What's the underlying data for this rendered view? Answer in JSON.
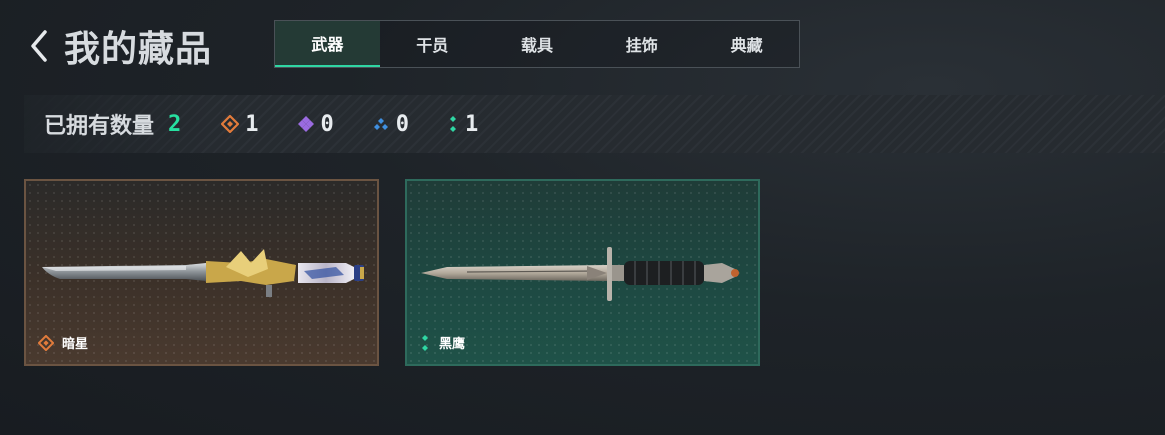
{
  "header": {
    "title": "我的藏品"
  },
  "tabs": [
    {
      "label": "武器",
      "active": true
    },
    {
      "label": "干员",
      "active": false
    },
    {
      "label": "载具",
      "active": false
    },
    {
      "label": "挂饰",
      "active": false
    },
    {
      "label": "典藏",
      "active": false
    }
  ],
  "stats": {
    "label": "已拥有数量",
    "total": "2",
    "rarities": [
      {
        "icon": "orange-diamond-icon",
        "color": "#e27b3b",
        "count": "1"
      },
      {
        "icon": "purple-diamond-icon",
        "color": "#9a6be0",
        "count": "0"
      },
      {
        "icon": "blue-diamond-icon",
        "color": "#3f8fe0",
        "count": "0"
      },
      {
        "icon": "green-diamond-icon",
        "color": "#2fd6a3",
        "count": "1"
      }
    ]
  },
  "items": [
    {
      "name": "暗星",
      "rarity_color": "#e27b3b",
      "icon": "orange-rarity-icon"
    },
    {
      "name": "黑鹰",
      "rarity_color": "#2fd6a3",
      "icon": "green-rarity-icon"
    }
  ],
  "colors": {
    "accent": "#2fd6a3",
    "total": "#27e0a0"
  }
}
